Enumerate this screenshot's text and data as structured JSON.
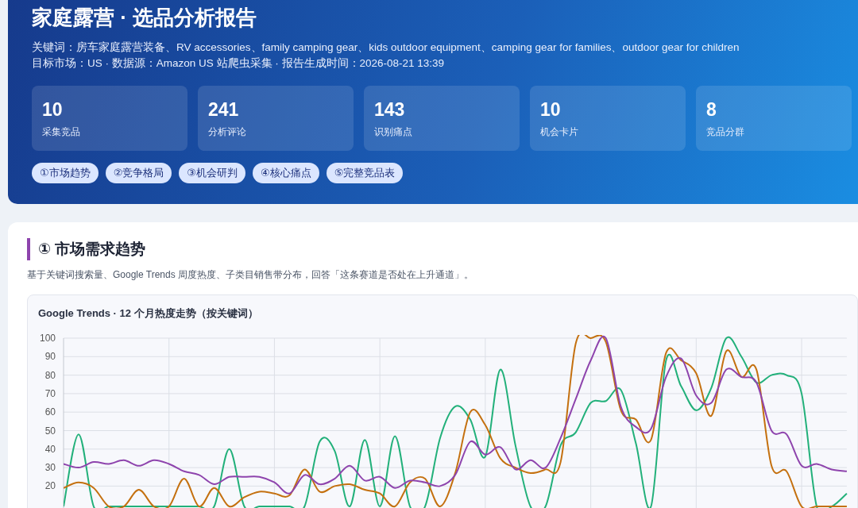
{
  "header": {
    "title": "家庭露营 · 选品分析报告",
    "keywords": "关键词：房车家庭露营装备、RV accessories、family camping gear、kids outdoor equipment、camping gear for families、outdoor gear for children",
    "meta": "目标市场：US · 数据源：Amazon US 站爬虫采集 · 报告生成时间：2026-08-21 13:39",
    "stats": [
      {
        "value": "10",
        "label": "采集竞品"
      },
      {
        "value": "241",
        "label": "分析评论"
      },
      {
        "value": "143",
        "label": "识别痛点"
      },
      {
        "value": "10",
        "label": "机会卡片"
      },
      {
        "value": "8",
        "label": "竞品分群"
      }
    ],
    "nav": [
      "①市场趋势",
      "②竞争格局",
      "③机会研判",
      "④核心痛点",
      "⑤完整竞品表"
    ]
  },
  "section": {
    "title": "① 市场需求趋势",
    "description": "基于关键词搜索量、Google Trends 周度热度、子类目销售带分布，回答「这条赛道是否处在上升通道」。",
    "chart": {
      "title": "Google Trends · 12 个月热度走势（按关键词）",
      "chart_data": {
        "type": "line",
        "grid": true,
        "ylim": [
          0,
          100
        ],
        "yticks": [
          20,
          30,
          40,
          50,
          60,
          70,
          80,
          90,
          100
        ],
        "series": [
          {
            "color": "#22b07a",
            "values": [
              9,
              48,
              9,
              9,
              9,
              9,
              9,
              9,
              9,
              9,
              9,
              40,
              9,
              9,
              9,
              9,
              9,
              44,
              39,
              9,
              45,
              9,
              47,
              9,
              9,
              46,
              63,
              56,
              36,
              83,
              42,
              9,
              9,
              42,
              49,
              65,
              66,
              72,
              43,
              9,
              88,
              74,
              61,
              73,
              100,
              90,
              76,
              80,
              80,
              70,
              9,
              9,
              16
            ]
          },
          {
            "color": "#c4700f",
            "values": [
              19,
              22,
              19,
              9,
              9,
              18,
              9,
              9,
              24,
              9,
              19,
              9,
              14,
              17,
              16,
              15,
              29,
              17,
              20,
              21,
              18,
              16,
              9,
              22,
              24,
              9,
              27,
              60,
              53,
              35,
              30,
              27,
              29,
              33,
              97,
              100,
              98,
              61,
              56,
              45,
              92,
              88,
              81,
              58,
              93,
              79,
              83,
              31,
              28,
              9,
              9,
              9,
              9
            ]
          },
          {
            "color": "#8e44ad",
            "values": [
              32,
              30,
              33,
              32,
              34,
              31,
              34,
              32,
              28,
              26,
              21,
              25,
              25,
              25,
              22,
              16,
              26,
              21,
              24,
              31,
              23,
              25,
              19,
              23,
              22,
              20,
              26,
              44,
              37,
              41,
              29,
              34,
              30,
              46,
              67,
              88,
              100,
              63,
              52,
              51,
              79,
              89,
              69,
              65,
              83,
              79,
              76,
              50,
              48,
              31,
              32,
              29,
              28
            ]
          }
        ]
      }
    }
  }
}
